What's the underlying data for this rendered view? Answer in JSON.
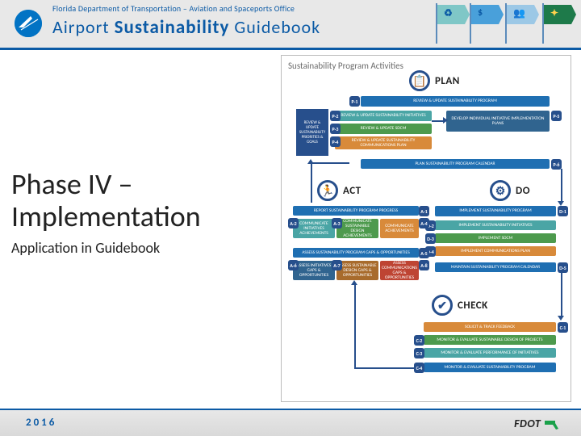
{
  "header": {
    "top": "Florida Department of Transportation – Aviation and Spaceports Office",
    "title_pre": "Airport ",
    "title_bold": "Sustainability",
    "title_post": " Guidebook"
  },
  "footer": {
    "year": "2016",
    "fdot": "FDOT"
  },
  "main": {
    "title_line1": "Phase IV –",
    "title_line2": "Implementation",
    "subtitle": "Application in Guidebook"
  },
  "diagram": {
    "title": "Sustainability Program Activities",
    "sections": {
      "plan": "PLAN",
      "do": "DO",
      "check": "CHECK",
      "act": "ACT"
    },
    "plan": {
      "header": "REVIEW & UPDATE SUSTAINABILITY PROGRAM",
      "side": "REVIEW & UPDATE SUSTAINABILITY PRIORITIES & GOALS",
      "p2": "REVIEW & UPDATE SUSTAINABILITY INITIATIVES",
      "p3": "REVIEW & UPDATE SDCM",
      "p4": "REVIEW & UPDATE SUSTAINABILITY COMMUNICATIONS PLAN",
      "p5": "DEVELOP INDIVIDUAL INITIATIVE IMPLEMENTATION PLANS",
      "footer": "PLAN SUSTAINABILITY PROGRAM CALENDAR",
      "nums": {
        "p1": "P-1",
        "p2": "P-2",
        "p3": "P-3",
        "p4": "P-4",
        "p5": "P-5",
        "p6": "P-6"
      }
    },
    "do": {
      "header": "IMPLEMENT SUSTAINABILITY PROGRAM",
      "d2": "IMPLEMENT SUSTAINABILITY INITIATIVES",
      "d3": "IMPLEMENT SDCM",
      "d4": "IMPLEMENT COMMUNICATIONS PLAN",
      "footer": "MAINTAIN SUSTAINABILITY PROGRAM CALENDAR",
      "nums": {
        "d1": "D-1",
        "d2": "D-2",
        "d3": "D-3",
        "d4": "D-4",
        "d5": "D-5"
      }
    },
    "check": {
      "c1": "SOLICIT & TRACK FEEDBACK",
      "c2": "MONITOR & EVALUATE SUSTAINABLE DESIGN OF PROJECTS",
      "c3": "MONITOR & EVALUATE PERFORMANCE OF INITIATIVES",
      "c4": "MONITOR & EVALUATE SUSTAINABILITY PROGRAM",
      "nums": {
        "c1": "C-1",
        "c2": "C-2",
        "c3": "C-3",
        "c4": "C-4"
      }
    },
    "act": {
      "header1": "REPORT SUSTAINABILITY PROGRAM PROGRESS",
      "a2": "COMMUNICATE INITIATIVES ACHIEVEMENTS",
      "a3": "COMMUNICATE SUSTAINABLE DESIGN ACHIEVEMENTS",
      "a4": "COMMUNICATE ACHIEVEMENTS",
      "header2": "ASSESS SUSTAINABILITY PROGRAM GAPS & OPPORTUNITIES",
      "a6": "ASSESS INITIATIVES GAPS & OPPORTUNITIES",
      "a7": "ASSESS SUSTAINABLE DESIGN GAPS & OPPORTUNITIES",
      "a8": "ASSESS COMMUNICATIONS GAPS & OPPORTUNITIES",
      "nums": {
        "a1": "A-1",
        "a2": "A-2",
        "a3": "A-3",
        "a4": "A-4",
        "a5": "A-5",
        "a6": "A-6",
        "a7": "A-7",
        "a8": "A-8"
      }
    }
  }
}
